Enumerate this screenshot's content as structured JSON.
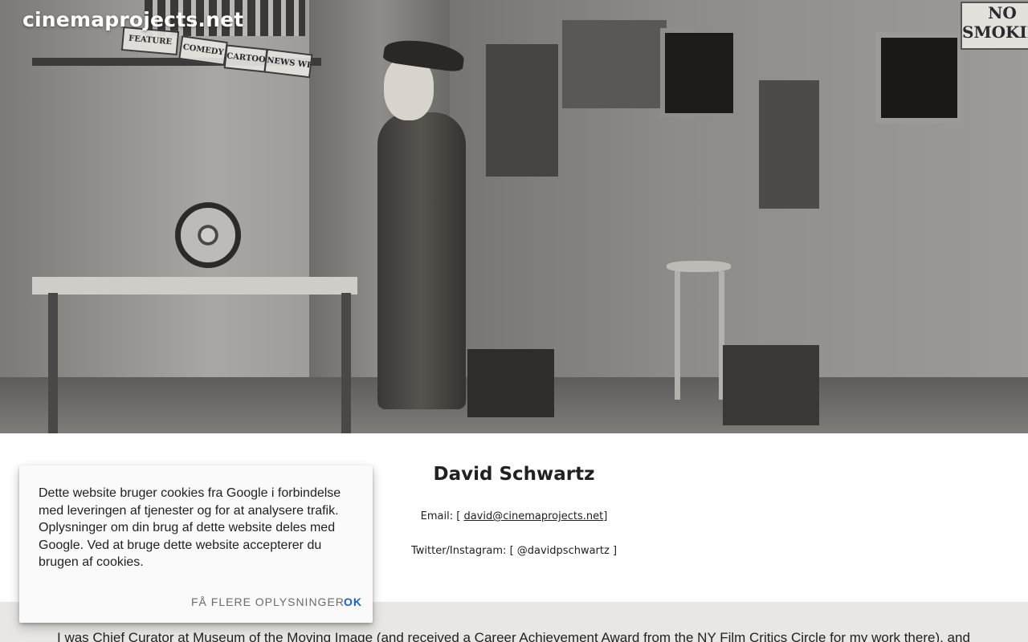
{
  "site": {
    "title": "cinemaprojects.net"
  },
  "hero": {
    "shelf_labels": [
      "FEATURE",
      "COMEDY",
      "CARTOON",
      "NEWS WEEKLY"
    ],
    "sign_lines": [
      "NO",
      "SMOKING"
    ]
  },
  "contact": {
    "name": "David Schwartz",
    "email_prefix": "Email: [ ",
    "email": "david@cinemaprojects.net",
    "email_suffix": "]",
    "social": "Twitter/Instagram: [ @davidpschwartz ]"
  },
  "bio": {
    "text": "I was Chief Curator at Museum of the Moving Image (and received a Career Achievement Award from the NY Film Critics Circle for my work there), and"
  },
  "cookie": {
    "message": "Dette website bruger cookies fra Google i forbindelse med leveringen af tjenester og for at analysere trafik. Oplysninger om din brug af dette website deles med Google. Ved at bruge dette website accepterer du brugen af cookies.",
    "more_label": "Få flere oplysninger",
    "ok_label": "OK"
  },
  "colors": {
    "accent": "#1a5fd0",
    "bio_background": "#e8e7e3"
  }
}
